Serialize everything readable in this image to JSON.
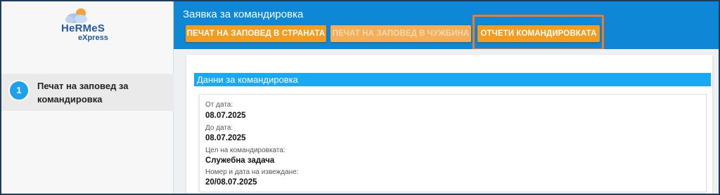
{
  "brand": {
    "line1": "HeRMeS",
    "line2": "eXpress"
  },
  "sidebar": {
    "steps": [
      {
        "number": "1",
        "label": "Печат на заповед за командировка"
      }
    ]
  },
  "header": {
    "title": "Заявка за командировка",
    "buttons": [
      {
        "label": "ПЕЧАТ НА ЗАПОВЕД В СТРАНАТА",
        "enabled": true
      },
      {
        "label": "ПЕЧАТ НА ЗАПОВЕД В ЧУЖБИНА",
        "enabled": false
      },
      {
        "label": "ОТЧЕТИ КОМАНДИРОВКАТА",
        "enabled": true
      }
    ]
  },
  "section": {
    "title": "Данни за командировка",
    "fields": [
      {
        "label": "От дата:",
        "value": "08.07.2025"
      },
      {
        "label": "До дата:",
        "value": "08.07.2025"
      },
      {
        "label": "Цел на командировката:",
        "value": "Служебна задача"
      },
      {
        "label": "Номер и дата на извеждане:",
        "value": "20/08.07.2025"
      }
    ]
  },
  "colors": {
    "header": "#0e87d6",
    "button": "#f39c1f",
    "highlight": "#f07b25",
    "section_header": "#17a9f4",
    "step_circle": "#1ea0ee"
  }
}
